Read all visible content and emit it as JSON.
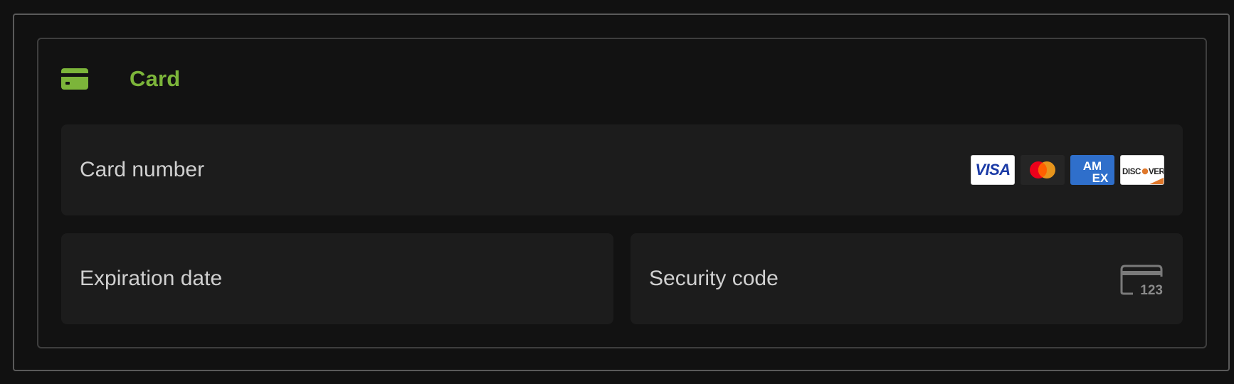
{
  "section": {
    "title": "Card",
    "icon": "credit-card-icon",
    "accent_color": "#7cb53a"
  },
  "fields": {
    "card_number": {
      "label": "Card number",
      "brands": [
        {
          "name": "Visa",
          "text": "VISA",
          "color": "#1a3aa6"
        },
        {
          "name": "Mastercard",
          "colors": [
            "#eb001b",
            "#f79e1b"
          ]
        },
        {
          "name": "American Express",
          "text": "AMEX",
          "color": "#2f6fcb"
        },
        {
          "name": "Discover",
          "text": "DISCOVER",
          "color": "#e0782b"
        }
      ]
    },
    "expiration": {
      "label": "Expiration date"
    },
    "security_code": {
      "label": "Security code",
      "icon": "cvc-card-icon",
      "icon_text": "123"
    }
  }
}
